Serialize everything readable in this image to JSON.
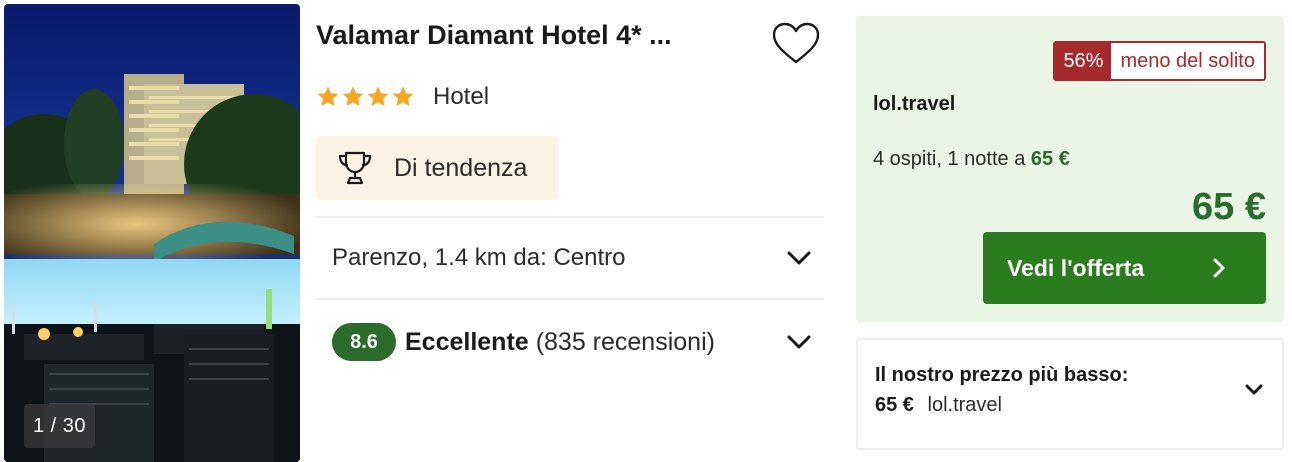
{
  "hotel": {
    "name": "Valamar Diamant Hotel 4* ...",
    "photo_counter": "1 / 30",
    "star_count": 4,
    "type": "Hotel",
    "badge": {
      "icon": "trophy-icon",
      "label": "Di tendenza"
    },
    "location": "Parenzo, 1.4 km da: Centro",
    "rating": {
      "score": "8.6",
      "label": "Eccellente",
      "count": "(835 recensioni)"
    }
  },
  "offer": {
    "discount_pct": "56%",
    "discount_text": "meno del solito",
    "provider": "lol.travel",
    "guests_text": "4 ospiti, 1 notte a",
    "guests_price": "65 €",
    "price": "65 €",
    "cta_label": "Vedi l'offerta"
  },
  "lowest_price": {
    "title": "Il nostro prezzo più basso:",
    "price": "65 €",
    "provider": "lol.travel"
  },
  "colors": {
    "accent_green": "#2b7b1f",
    "price_green": "#2b6b2b",
    "discount_red": "#a42a2e",
    "offer_bg": "#ebf5e6",
    "star": "#f5a623",
    "trend_bg": "#fdf2e4"
  }
}
